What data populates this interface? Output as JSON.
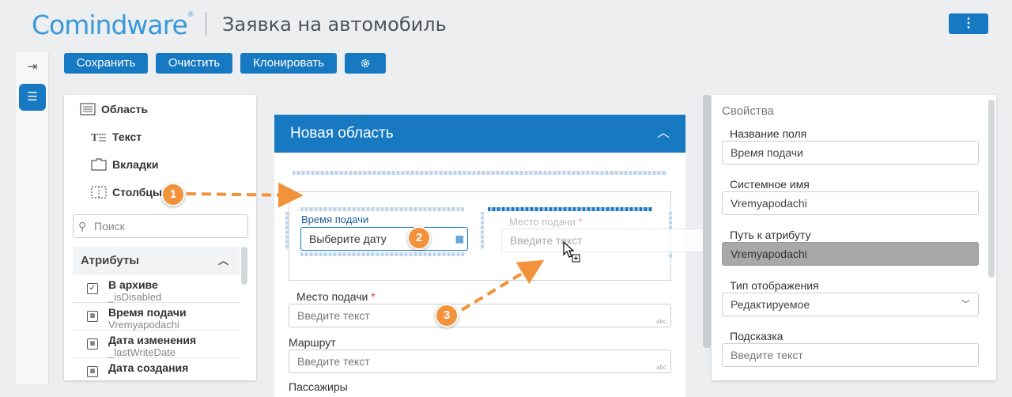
{
  "header": {
    "logo_text": "Comindware",
    "logo_reg": "®",
    "page_title": "Заявка на автомобиль",
    "menu_icon": "kebab-vertical-icon"
  },
  "rail": {
    "collapse_icon": "collapse-right-icon",
    "list_icon": "hamburger-icon"
  },
  "toolbar": {
    "save_label": "Сохранить",
    "clear_label": "Очистить",
    "clone_label": "Клонировать",
    "settings_icon": "gear-icon"
  },
  "palette": {
    "tools": [
      {
        "label": "Область",
        "icon": "area-icon"
      },
      {
        "label": "Текст",
        "icon": "text-icon"
      },
      {
        "label": "Вкладки",
        "icon": "tabs-icon"
      },
      {
        "label": "Столбцы",
        "icon": "columns-icon"
      }
    ],
    "search_placeholder": "Поиск",
    "attributes_title": "Атрибуты",
    "attributes": [
      {
        "name": "В архиве",
        "system": "_isDisabled",
        "icon": "checkbox-icon"
      },
      {
        "name": "Время подачи",
        "system": "Vremyapodachi",
        "icon": "calendar-icon"
      },
      {
        "name": "Дата изменения",
        "system": "_lastWriteDate",
        "icon": "calendar-icon"
      },
      {
        "name": "Дата создания",
        "system": "",
        "icon": "calendar-icon"
      }
    ]
  },
  "form": {
    "area_title": "Новая область",
    "col1_label": "Время подачи",
    "col1_placeholder": "Выберите дату",
    "col2_label": "Место подачи",
    "col2_placeholder": "Введите текст",
    "fields": [
      {
        "label": "Место подачи",
        "required": true,
        "placeholder": "Введите текст",
        "badge": "abc"
      },
      {
        "label": "Маршрут",
        "required": false,
        "placeholder": "Введите текст",
        "badge": "abc"
      },
      {
        "label": "Пассажиры",
        "required": false,
        "placeholder": "",
        "badge": ""
      }
    ],
    "required_mark": "*"
  },
  "properties": {
    "title": "Свойства",
    "field_name_label": "Название поля",
    "field_name_value": "Время подачи",
    "system_name_label": "Системное имя",
    "system_name_value": "Vremyapodachi",
    "attr_path_label": "Путь к атрибуту",
    "attr_path_value": "Vremyapodachi",
    "display_type_label": "Тип отображения",
    "display_type_value": "Редактируемое",
    "hint_label": "Подсказка",
    "hint_placeholder": "Введите текст"
  },
  "markers": [
    "1",
    "2",
    "3"
  ],
  "colors": {
    "accent": "#1679c2",
    "marker": "#f2923a",
    "background": "#eceef0"
  }
}
